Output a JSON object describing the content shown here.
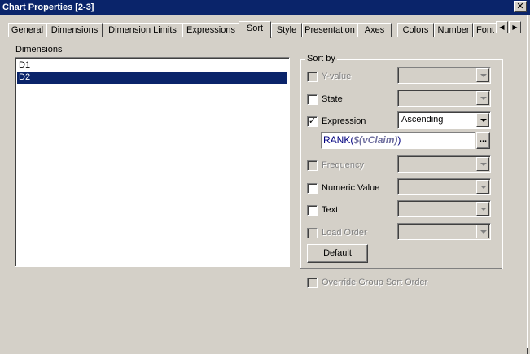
{
  "window": {
    "title": "Chart Properties [2-3]",
    "close_glyph": "✕"
  },
  "tabs": [
    {
      "label": "General",
      "active": false
    },
    {
      "label": "Dimensions",
      "active": false
    },
    {
      "label": "Dimension Limits",
      "active": false
    },
    {
      "label": "Expressions",
      "active": false
    },
    {
      "label": "Sort",
      "active": true
    },
    {
      "label": "Style",
      "active": false
    },
    {
      "label": "Presentation",
      "active": false
    },
    {
      "label": "Axes",
      "active": false
    },
    {
      "label": "Colors",
      "active": false
    },
    {
      "label": "Number",
      "active": false
    },
    {
      "label": "Font",
      "active": false
    }
  ],
  "tab_scroll": {
    "left_glyph": "◀",
    "right_glyph": "▶"
  },
  "dimensions": {
    "label": "Dimensions",
    "items": [
      {
        "label": "D1",
        "selected": false
      },
      {
        "label": "D2",
        "selected": true
      }
    ]
  },
  "sort_by": {
    "title": "Sort by",
    "options": [
      {
        "key": "y_value",
        "label": "Y-value",
        "checked": false,
        "enabled": false,
        "combo_value": "",
        "combo_enabled": false
      },
      {
        "key": "state",
        "label": "State",
        "checked": false,
        "enabled": true,
        "combo_value": "",
        "combo_enabled": false
      },
      {
        "key": "expression",
        "label": "Expression",
        "checked": true,
        "enabled": true,
        "combo_value": "Ascending",
        "combo_enabled": true
      },
      {
        "key": "frequency",
        "label": "Frequency",
        "checked": false,
        "enabled": false,
        "combo_value": "",
        "combo_enabled": false
      },
      {
        "key": "numeric_value",
        "label": "Numeric Value",
        "checked": false,
        "enabled": true,
        "combo_value": "",
        "combo_enabled": false
      },
      {
        "key": "text",
        "label": "Text",
        "checked": false,
        "enabled": true,
        "combo_value": "",
        "combo_enabled": false
      },
      {
        "key": "load_order",
        "label": "Load Order",
        "checked": false,
        "enabled": false,
        "combo_value": "",
        "combo_enabled": false
      }
    ],
    "expression_text": {
      "prefix": "RANK(",
      "variable": "$(vClaim)",
      "suffix": ")"
    },
    "ellipsis_label": "...",
    "default_button": "Default"
  },
  "override": {
    "label": "Override Group Sort Order",
    "checked": false,
    "enabled": false
  },
  "check_glyph": "✓"
}
